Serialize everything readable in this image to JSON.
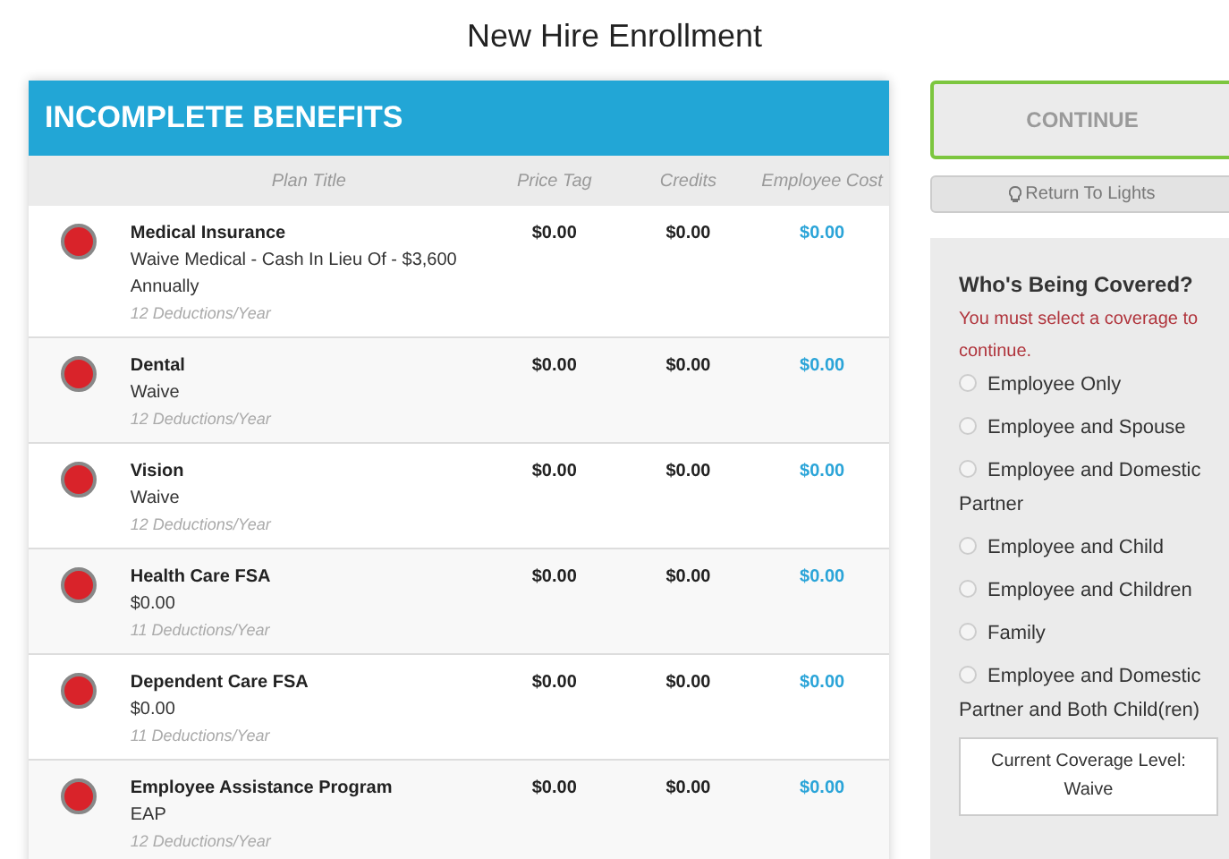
{
  "page_title": "New Hire Enrollment",
  "panel": {
    "title": "INCOMPLETE BENEFITS",
    "columns": [
      "Plan Title",
      "Price Tag",
      "Credits",
      "Employee Cost"
    ],
    "rows": [
      {
        "name": "Medical Insurance",
        "plan": "Waive Medical - Cash In Lieu Of - $3,600 Annually",
        "deductions": "12 Deductions/Year",
        "price_tag": "$0.00",
        "credits": "$0.00",
        "employee_cost": "$0.00"
      },
      {
        "name": "Dental",
        "plan": "Waive",
        "deductions": "12 Deductions/Year",
        "price_tag": "$0.00",
        "credits": "$0.00",
        "employee_cost": "$0.00"
      },
      {
        "name": "Vision",
        "plan": "Waive",
        "deductions": "12 Deductions/Year",
        "price_tag": "$0.00",
        "credits": "$0.00",
        "employee_cost": "$0.00"
      },
      {
        "name": "Health Care FSA",
        "plan": "$0.00",
        "deductions": "11 Deductions/Year",
        "price_tag": "$0.00",
        "credits": "$0.00",
        "employee_cost": "$0.00"
      },
      {
        "name": "Dependent Care FSA",
        "plan": "$0.00",
        "deductions": "11 Deductions/Year",
        "price_tag": "$0.00",
        "credits": "$0.00",
        "employee_cost": "$0.00"
      },
      {
        "name": "Employee Assistance Program",
        "plan": "EAP",
        "deductions": "12 Deductions/Year",
        "price_tag": "$0.00",
        "credits": "$0.00",
        "employee_cost": "$0.00"
      }
    ]
  },
  "continue_button": {
    "label": "CONTINUE",
    "disabled": true
  },
  "return_button": {
    "label": "Return To Lights"
  },
  "coverage": {
    "title": "Who's Being Covered?",
    "error": "You must select a coverage to continue.",
    "options": [
      {
        "label": "Employee Only",
        "selected": false
      },
      {
        "label": "Employee and Spouse",
        "selected": false
      },
      {
        "label": "Employee and Domestic Partner",
        "selected": false
      },
      {
        "label": "Employee and Child",
        "selected": false
      },
      {
        "label": "Employee and Children",
        "selected": false
      },
      {
        "label": "Family",
        "selected": false
      },
      {
        "label": "Employee and Domestic Partner and Both Child(ren)",
        "selected": false
      }
    ],
    "current_label": "Current Coverage Level:",
    "current_value": "Waive"
  }
}
